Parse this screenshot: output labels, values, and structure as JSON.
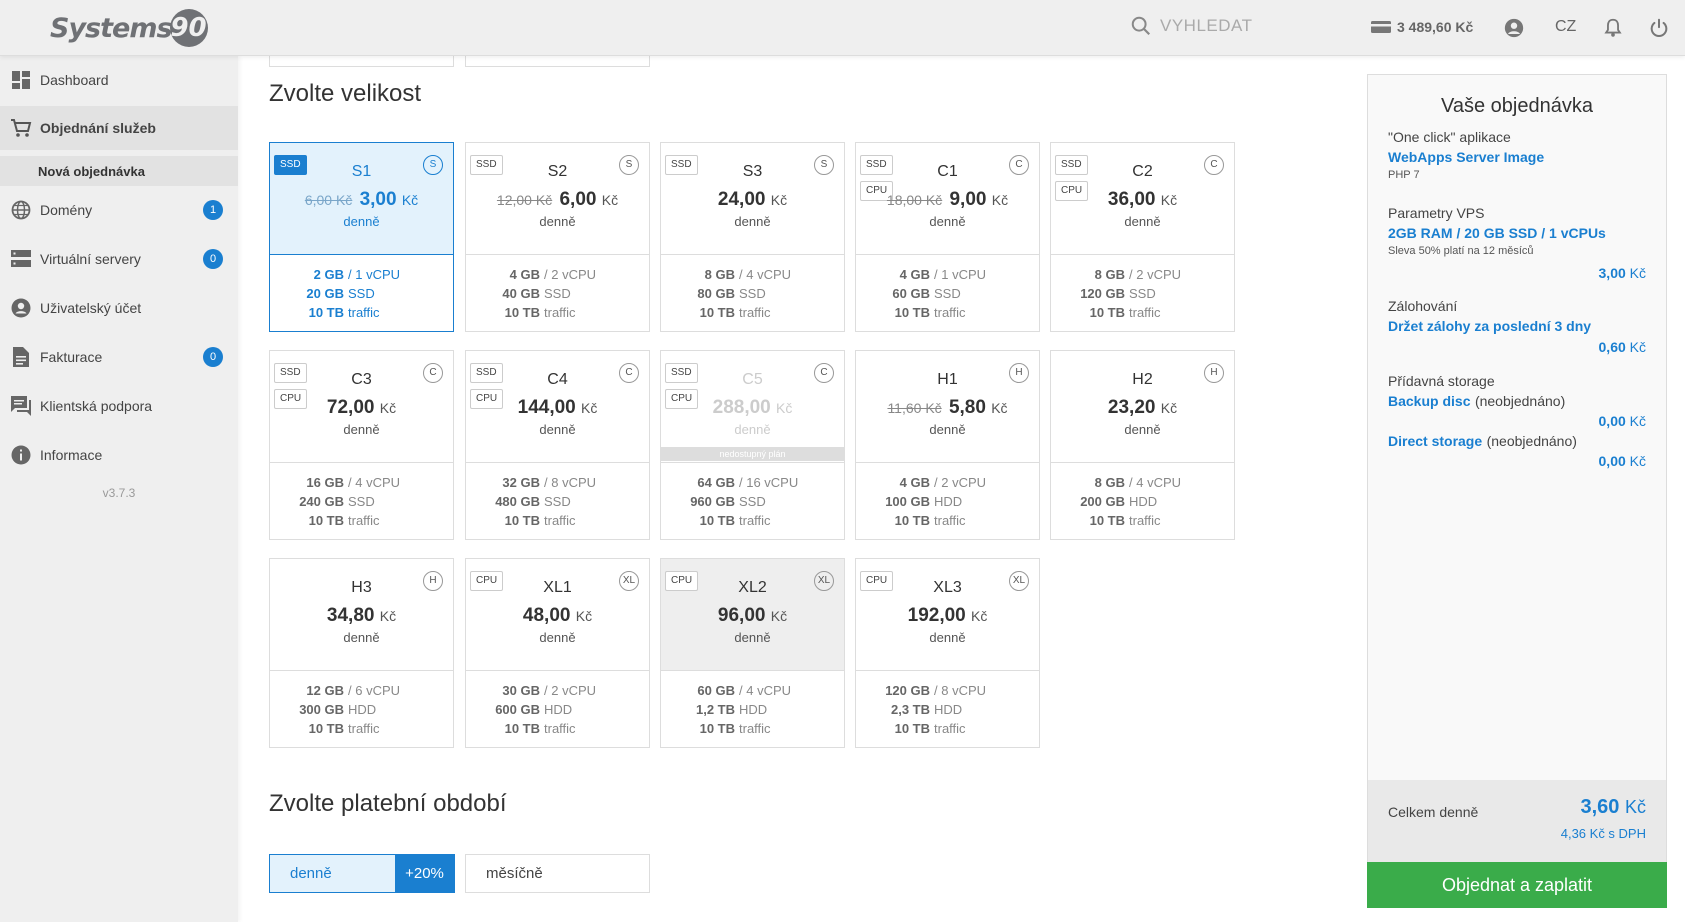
{
  "header": {
    "logo_text": "Systems",
    "logo_number": "90",
    "search_placeholder": "VYHLEDAT",
    "credit": "3 489,60 Kč",
    "language": "CZ"
  },
  "sidebar": {
    "items": [
      {
        "label": "Dashboard",
        "icon": "dashboard-icon"
      },
      {
        "label": "Objednání služeb",
        "icon": "cart-icon"
      },
      {
        "label": "Domény",
        "icon": "globe-icon",
        "badge": "1"
      },
      {
        "label": "Virtuální servery",
        "icon": "server-icon",
        "badge": "0"
      },
      {
        "label": "Uživatelský účet",
        "icon": "user-icon"
      },
      {
        "label": "Fakturace",
        "icon": "invoice-icon",
        "badge": "0"
      },
      {
        "label": "Klientská podpora",
        "icon": "support-icon"
      },
      {
        "label": "Informace",
        "icon": "info-icon"
      }
    ],
    "sub_item": "Nová objednávka",
    "version": "v3.7.3"
  },
  "size_section": {
    "title": "Zvolte velikost",
    "plans": [
      {
        "name": "S1",
        "old": "6,00 Kč",
        "price": "3,00",
        "cur": "Kč",
        "period": "denně",
        "cat": "S",
        "ssd": true,
        "cpu": false,
        "ram": "2 GB",
        "vcpu": "/ 1 vCPU",
        "disk": "20 GB",
        "disk_type": "SSD",
        "traffic": "10 TB",
        "traffic_u": "traffic",
        "state": "selected"
      },
      {
        "name": "S2",
        "old": "12,00 Kč",
        "price": "6,00",
        "cur": "Kč",
        "period": "denně",
        "cat": "S",
        "ssd": true,
        "cpu": false,
        "ram": "4 GB",
        "vcpu": "/ 2 vCPU",
        "disk": "40 GB",
        "disk_type": "SSD",
        "traffic": "10 TB",
        "traffic_u": "traffic",
        "state": ""
      },
      {
        "name": "S3",
        "old": "",
        "price": "24,00",
        "cur": "Kč",
        "period": "denně",
        "cat": "S",
        "ssd": true,
        "cpu": false,
        "ram": "8 GB",
        "vcpu": "/ 4 vCPU",
        "disk": "80 GB",
        "disk_type": "SSD",
        "traffic": "10 TB",
        "traffic_u": "traffic",
        "state": ""
      },
      {
        "name": "C1",
        "old": "18,00 Kč",
        "price": "9,00",
        "cur": "Kč",
        "period": "denně",
        "cat": "C",
        "ssd": true,
        "cpu": true,
        "ram": "4 GB",
        "vcpu": "/ 1 vCPU",
        "disk": "60 GB",
        "disk_type": "SSD",
        "traffic": "10 TB",
        "traffic_u": "traffic",
        "state": ""
      },
      {
        "name": "C2",
        "old": "",
        "price": "36,00",
        "cur": "Kč",
        "period": "denně",
        "cat": "C",
        "ssd": true,
        "cpu": true,
        "ram": "8 GB",
        "vcpu": "/ 2 vCPU",
        "disk": "120 GB",
        "disk_type": "SSD",
        "traffic": "10 TB",
        "traffic_u": "traffic",
        "state": ""
      },
      {
        "name": "C3",
        "old": "",
        "price": "72,00",
        "cur": "Kč",
        "period": "denně",
        "cat": "C",
        "ssd": true,
        "cpu": true,
        "ram": "16 GB",
        "vcpu": "/ 4 vCPU",
        "disk": "240 GB",
        "disk_type": "SSD",
        "traffic": "10 TB",
        "traffic_u": "traffic",
        "state": ""
      },
      {
        "name": "C4",
        "old": "",
        "price": "144,00",
        "cur": "Kč",
        "period": "denně",
        "cat": "C",
        "ssd": true,
        "cpu": true,
        "ram": "32 GB",
        "vcpu": "/ 8 vCPU",
        "disk": "480 GB",
        "disk_type": "SSD",
        "traffic": "10 TB",
        "traffic_u": "traffic",
        "state": ""
      },
      {
        "name": "C5",
        "old": "",
        "price": "288,00",
        "cur": "Kč",
        "period": "denně",
        "cat": "C",
        "ssd": true,
        "cpu": true,
        "ram": "64 GB",
        "vcpu": "/ 16 vCPU",
        "disk": "960 GB",
        "disk_type": "SSD",
        "traffic": "10 TB",
        "traffic_u": "traffic",
        "state": "unavail",
        "unavail_label": "nedostupný plán"
      },
      {
        "name": "H1",
        "old": "11,60 Kč",
        "price": "5,80",
        "cur": "Kč",
        "period": "denně",
        "cat": "H",
        "ssd": false,
        "cpu": false,
        "ram": "4 GB",
        "vcpu": "/ 2 vCPU",
        "disk": "100 GB",
        "disk_type": "HDD",
        "traffic": "10 TB",
        "traffic_u": "traffic",
        "state": ""
      },
      {
        "name": "H2",
        "old": "",
        "price": "23,20",
        "cur": "Kč",
        "period": "denně",
        "cat": "H",
        "ssd": false,
        "cpu": false,
        "ram": "8 GB",
        "vcpu": "/ 4 vCPU",
        "disk": "200 GB",
        "disk_type": "HDD",
        "traffic": "10 TB",
        "traffic_u": "traffic",
        "state": ""
      },
      {
        "name": "H3",
        "old": "",
        "price": "34,80",
        "cur": "Kč",
        "period": "denně",
        "cat": "H",
        "ssd": false,
        "cpu": false,
        "ram": "12 GB",
        "vcpu": "/ 6 vCPU",
        "disk": "300 GB",
        "disk_type": "HDD",
        "traffic": "10 TB",
        "traffic_u": "traffic",
        "state": ""
      },
      {
        "name": "XL1",
        "old": "",
        "price": "48,00",
        "cur": "Kč",
        "period": "denně",
        "cat": "XL",
        "ssd": false,
        "cpu": true,
        "ram": "30 GB",
        "vcpu": "/ 2 vCPU",
        "disk": "600 GB",
        "disk_type": "HDD",
        "traffic": "10 TB",
        "traffic_u": "traffic",
        "state": ""
      },
      {
        "name": "XL2",
        "old": "",
        "price": "96,00",
        "cur": "Kč",
        "period": "denně",
        "cat": "XL",
        "ssd": false,
        "cpu": true,
        "ram": "60 GB",
        "vcpu": "/ 4 vCPU",
        "disk": "1,2 TB",
        "disk_type": "HDD",
        "traffic": "10 TB",
        "traffic_u": "traffic",
        "state": "grey"
      },
      {
        "name": "XL3",
        "old": "",
        "price": "192,00",
        "cur": "Kč",
        "period": "denně",
        "cat": "XL",
        "ssd": false,
        "cpu": true,
        "ram": "120 GB",
        "vcpu": "/ 8 vCPU",
        "disk": "2,3 TB",
        "disk_type": "HDD",
        "traffic": "10 TB",
        "traffic_u": "traffic",
        "state": ""
      }
    ],
    "tag_ssd": "SSD",
    "tag_cpu": "CPU"
  },
  "period_section": {
    "title": "Zvolte platební období",
    "daily": "denně",
    "daily_bonus": "+20%",
    "monthly": "měsíčně"
  },
  "order": {
    "title": "Vaše objednávka",
    "app_label": "\"One click\" aplikace",
    "app_name": "WebApps Server Image",
    "app_note": "PHP 7",
    "vps_label": "Parametry VPS",
    "vps_value": "2GB RAM / 20 GB SSD / 1 vCPUs",
    "vps_note": "Sleva 50% platí na 12 měsíců",
    "vps_price": "3,00",
    "backup_label": "Zálohování",
    "backup_value": "Držet zálohy za poslední 3 dny",
    "backup_price": "0,60",
    "storage_label": "Přídavná storage",
    "backup_disc": "Backup disc",
    "backup_disc_note": "(neobjednáno)",
    "backup_disc_price": "0,00",
    "direct_storage": "Direct storage",
    "direct_storage_note": "(neobjednáno)",
    "direct_storage_price": "0,00",
    "currency": "Kč",
    "total_label": "Celkem denně",
    "total_price": "3,60",
    "total_vat": "4,36 Kč s DPH",
    "submit": "Objednat a zaplatit"
  },
  "colors": {
    "accent": "#1a7fd0",
    "success": "#3aac4a",
    "sidebar_bg": "#efefef"
  }
}
